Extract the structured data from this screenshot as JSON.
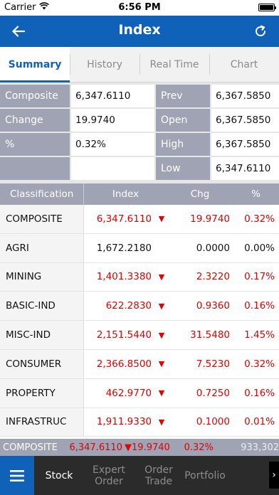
{
  "status_bar": {
    "carrier": "Carrier",
    "time": "6:56 PM"
  },
  "header": {
    "title": "Index"
  },
  "tabs": [
    {
      "label": "Summary",
      "active": true
    },
    {
      "label": "History",
      "active": false
    },
    {
      "label": "Real Time",
      "active": false
    },
    {
      "label": "Chart",
      "active": false
    }
  ],
  "summary": {
    "left": [
      {
        "label": "Composite",
        "value": "6,347.6110"
      },
      {
        "label": "Change",
        "value": "19.9740"
      },
      {
        "label": "%",
        "value": "0.32%"
      },
      {
        "label": "",
        "value": ""
      }
    ],
    "right": [
      {
        "label": "Prev",
        "value": "6,367.5850"
      },
      {
        "label": "Open",
        "value": "6,367.5850"
      },
      {
        "label": "High",
        "value": "6,367.5850"
      },
      {
        "label": "Low",
        "value": "6,347.6110"
      }
    ]
  },
  "table": {
    "headers": {
      "classification": "Classification",
      "index": "Index",
      "chg": "Chg",
      "pct": "%"
    },
    "rows": [
      {
        "name": "COMPOSITE",
        "index": "6,347.6110",
        "chg": "19.9740",
        "pct": "0.32%",
        "down": true
      },
      {
        "name": "AGRI",
        "index": "1,672.2180",
        "chg": "0.0000",
        "pct": "0.00%",
        "down": false
      },
      {
        "name": "MINING",
        "index": "1,401.3380",
        "chg": "2.3220",
        "pct": "0.17%",
        "down": true
      },
      {
        "name": "BASIC-IND",
        "index": "622.2830",
        "chg": "0.9360",
        "pct": "0.16%",
        "down": true
      },
      {
        "name": "MISC-IND",
        "index": "2,151.5440",
        "chg": "31.5480",
        "pct": "1.45%",
        "down": true
      },
      {
        "name": "CONSUMER",
        "index": "2,366.8500",
        "chg": "7.5230",
        "pct": "0.32%",
        "down": true
      },
      {
        "name": "PROPERTY",
        "index": "462.9770",
        "chg": "0.7250",
        "pct": "0.16%",
        "down": true
      },
      {
        "name": "INFRASTRUC",
        "index": "1,911.9330",
        "chg": "0.1000",
        "pct": "0.01%",
        "down": true
      }
    ]
  },
  "ticker": {
    "name": "COMPOSITE",
    "index": "6,347.6110",
    "chg": "▼19.9740",
    "pct": "0.32%",
    "volume": "933,302"
  },
  "bottom_nav": {
    "items": [
      "Stock",
      "Expert Order",
      "Order Trade",
      "Portfolio"
    ],
    "more_icon": "chevron-right-icon"
  },
  "colors": {
    "brand_blue": "#0f62b8",
    "down_red": "#e30000",
    "label_gray": "#9fa3b3"
  }
}
